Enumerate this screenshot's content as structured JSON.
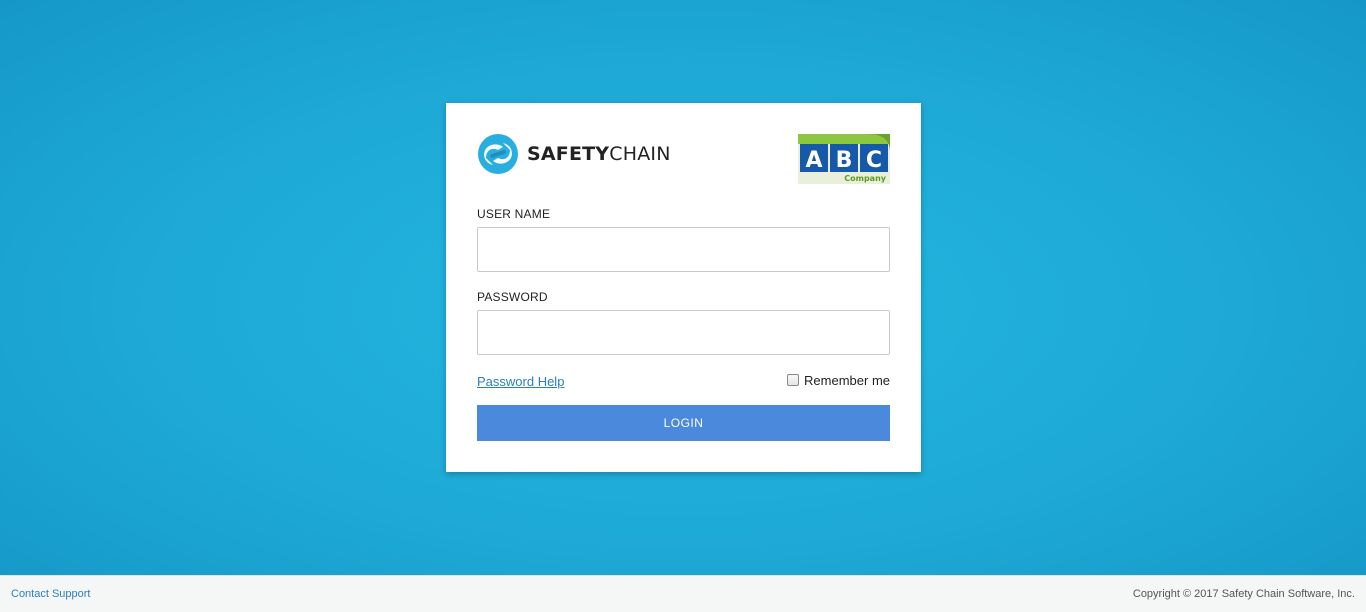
{
  "brand": {
    "name_bold": "SAFETY",
    "name_regular": "CHAIN"
  },
  "client_logo": {
    "letters": [
      "A",
      "B",
      "C"
    ],
    "subtitle": "Company"
  },
  "form": {
    "username_label": "USER NAME",
    "username_value": "",
    "password_label": "PASSWORD",
    "password_value": "",
    "password_help": "Password Help",
    "remember_me": "Remember me",
    "remember_checked": false,
    "login_label": "LOGIN"
  },
  "footer": {
    "contact": "Contact Support",
    "copyright": "Copyright © 2017 Safety Chain Software, Inc."
  },
  "colors": {
    "background": "#22b7df",
    "accent": "#4a89dc",
    "link": "#2a7fc0",
    "brand_blue": "#29aee0",
    "client_blue": "#1659a8",
    "client_green": "#8dc63f"
  }
}
